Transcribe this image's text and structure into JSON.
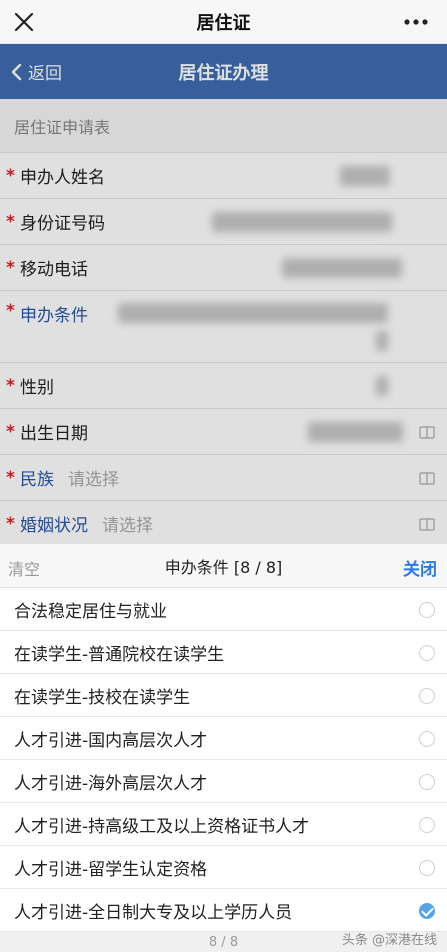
{
  "topbar": {
    "title": "居住证"
  },
  "header": {
    "back_label": "返回",
    "title": "居住证办理"
  },
  "form": {
    "section_title": "居住证申请表",
    "rows": [
      {
        "label": "申办人姓名"
      },
      {
        "label": "身份证号码"
      },
      {
        "label": "移动电话"
      },
      {
        "label": "申办条件"
      },
      {
        "label": "性别"
      },
      {
        "label": "出生日期"
      },
      {
        "label": "民族",
        "placeholder": "请选择"
      },
      {
        "label": "婚姻状况",
        "placeholder": "请选择"
      }
    ]
  },
  "picker": {
    "clear_label": "清空",
    "title": "申办条件 [8 / 8]",
    "close_label": "关闭",
    "options": [
      "合法稳定居住与就业",
      "在读学生-普通院校在读学生",
      "在读学生-技校在读学生",
      "人才引进-国内高层次人才",
      "人才引进-海外高层次人才",
      "人才引进-持高级工及以上资格证书人才",
      "人才引进-留学生认定资格",
      "人才引进-全日制大专及以上学历人员"
    ],
    "selected_index": 7,
    "page_indicator": "8 / 8"
  },
  "watermark": "头条 @深港在线",
  "colors": {
    "header_blue": "#3f6db2",
    "link_blue": "#2a7ae2",
    "required_red": "#d9232a"
  }
}
